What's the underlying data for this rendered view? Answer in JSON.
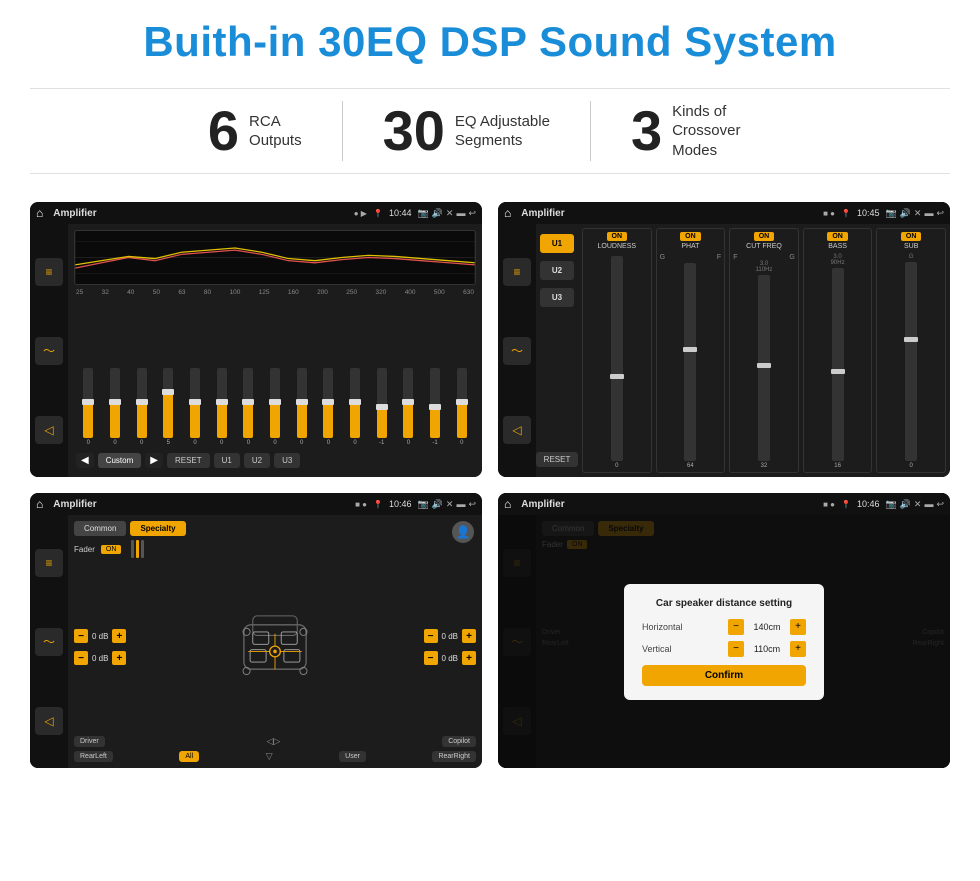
{
  "page": {
    "title": "Buith-in 30EQ DSP Sound System"
  },
  "features": [
    {
      "num": "6",
      "desc_line1": "RCA",
      "desc_line2": "Outputs"
    },
    {
      "num": "30",
      "desc_line1": "EQ Adjustable",
      "desc_line2": "Segments"
    },
    {
      "num": "3",
      "desc_line1": "Kinds of",
      "desc_line2": "Crossover Modes"
    }
  ],
  "screens": [
    {
      "id": "screen1",
      "statusbar": {
        "home": "⌂",
        "title": "Amplifier",
        "dots": "● ▶",
        "pin": "📍",
        "time": "10:44",
        "icons": [
          "📷",
          "🔊",
          "✕",
          "▬",
          "↩"
        ]
      },
      "label": "EQ Screen"
    },
    {
      "id": "screen2",
      "statusbar": {
        "home": "⌂",
        "title": "Amplifier",
        "dots": "■ ●",
        "time": "10:45",
        "icons": [
          "📷",
          "🔊",
          "✕",
          "▬",
          "↩"
        ]
      },
      "label": "Amplifier Screen"
    },
    {
      "id": "screen3",
      "statusbar": {
        "home": "⌂",
        "title": "Amplifier",
        "dots": "■ ●",
        "time": "10:46",
        "icons": [
          "📷",
          "🔊",
          "✕",
          "▬",
          "↩"
        ]
      },
      "label": "Fader Screen"
    },
    {
      "id": "screen4",
      "statusbar": {
        "home": "⌂",
        "title": "Amplifier",
        "dots": "■ ●",
        "time": "10:46",
        "icons": [
          "📷",
          "🔊",
          "✕",
          "▬",
          "↩"
        ]
      },
      "label": "Dialog Screen",
      "dialog": {
        "title": "Car speaker distance setting",
        "horizontal_label": "Horizontal",
        "horizontal_value": "140cm",
        "vertical_label": "Vertical",
        "vertical_value": "110cm",
        "confirm_label": "Confirm"
      }
    }
  ],
  "eq": {
    "freqs": [
      "25",
      "32",
      "40",
      "50",
      "63",
      "80",
      "100",
      "125",
      "160",
      "200",
      "250",
      "320",
      "400",
      "500",
      "630"
    ],
    "values": [
      "0",
      "0",
      "0",
      "5",
      "0",
      "0",
      "0",
      "0",
      "0",
      "0",
      "0",
      "-1",
      "0",
      "-1"
    ],
    "preset": "Custom",
    "buttons": [
      "RESET",
      "U1",
      "U2",
      "U3"
    ]
  },
  "amp": {
    "presets": [
      "U1",
      "U2",
      "U3"
    ],
    "channels": [
      {
        "label": "LOUDNESS",
        "on": true
      },
      {
        "label": "PHAT",
        "on": true
      },
      {
        "label": "CUT FREQ",
        "on": true
      },
      {
        "label": "BASS",
        "on": true
      },
      {
        "label": "SUB",
        "on": true
      }
    ],
    "reset_label": "RESET"
  },
  "fader": {
    "tabs": [
      "Common",
      "Specialty"
    ],
    "active_tab": "Specialty",
    "fader_label": "Fader",
    "fader_on": "ON",
    "db_values": [
      "0 dB",
      "0 dB",
      "0 dB",
      "0 dB"
    ],
    "bottom_buttons": [
      "Driver",
      "",
      "Copilot",
      "RearLeft",
      "All",
      "User",
      "RearRight"
    ]
  }
}
